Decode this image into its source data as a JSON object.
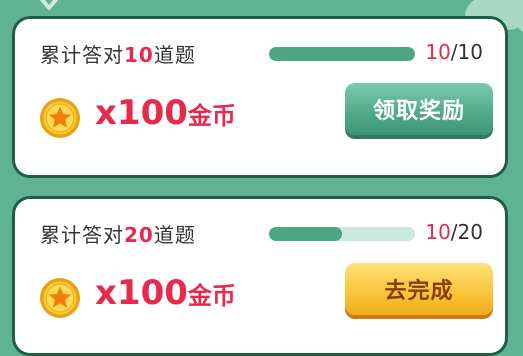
{
  "tasks": [
    {
      "title_prefix": "累计答对",
      "title_number": "10",
      "title_suffix": "道题",
      "progress_current": "10",
      "progress_separator": "/",
      "progress_total": "10",
      "progress_fraction": 1.0,
      "reward_amount": "x100",
      "reward_unit": "金币",
      "button_label": "领取奖励",
      "button_state": "claim"
    },
    {
      "title_prefix": "累计答对",
      "title_number": "20",
      "title_suffix": "道题",
      "progress_current": "10",
      "progress_separator": "/",
      "progress_total": "20",
      "progress_fraction": 0.5,
      "reward_amount": "x100",
      "reward_unit": "金币",
      "button_label": "去完成",
      "button_state": "go"
    }
  ],
  "colors": {
    "background": "#5fb394",
    "accent_red": "#e8294d",
    "progress_fill": "#4aa683",
    "progress_track": "#cbe8df"
  },
  "icons": {
    "coin": "coin-star-icon"
  }
}
